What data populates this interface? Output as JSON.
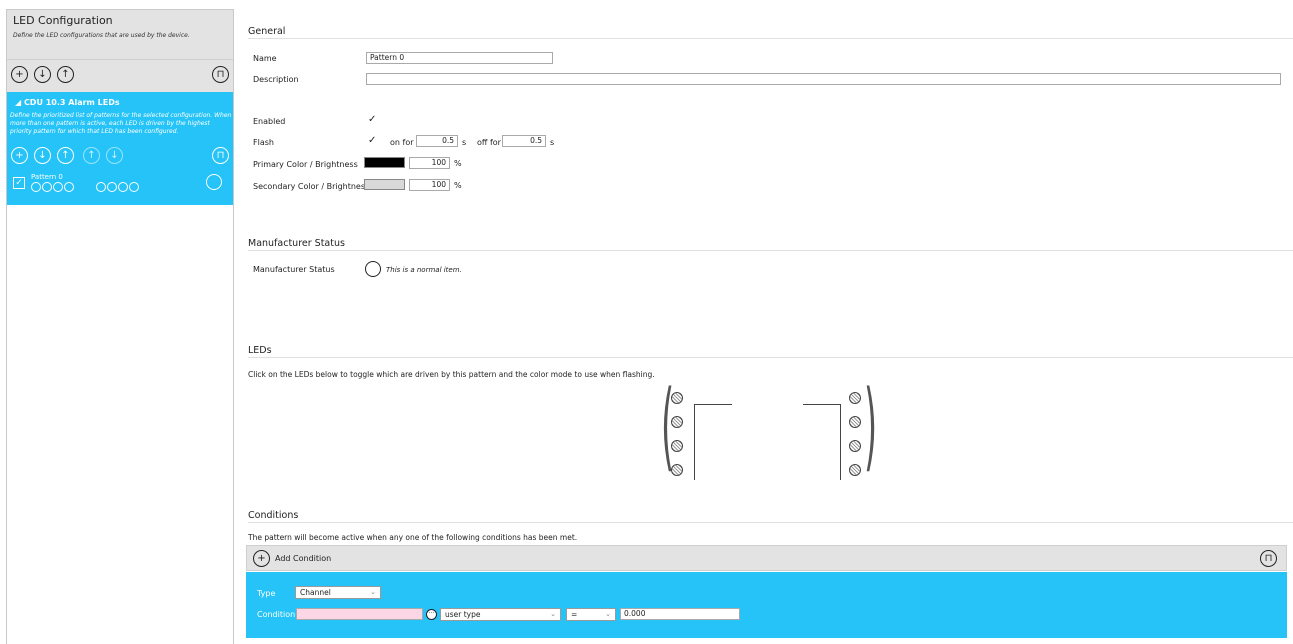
{
  "left_panel": {
    "title": "LED Configuration",
    "description": "Define the LED configurations that are used by the device.",
    "config": {
      "title": "◢  CDU 10.3 Alarm LEDs",
      "description": "Define the prioritized list of patterns for the selected configuration. When more than one pattern is active, each LED is driven by the highest priority pattern for which that LED has been configured.",
      "pattern_name": "Pattern 0",
      "pattern_check": "✓"
    }
  },
  "general": {
    "section_title": "General",
    "name_label": "Name",
    "name_value": "Pattern 0",
    "description_label": "Description",
    "description_value": "",
    "enabled_label": "Enabled",
    "enabled_check": "✓",
    "flash_label": "Flash",
    "flash_check": "✓",
    "on_for_label": "on for",
    "on_for_value": "0.5",
    "on_unit": "s",
    "off_for_label": "off for",
    "off_for_value": "0.5",
    "off_unit": "s",
    "primary_label": "Primary Color / Brightness",
    "primary_color": "#000000",
    "primary_brightness": "100",
    "primary_unit": "%",
    "secondary_label": "Secondary Color / Brightness",
    "secondary_color": "#d9d9d9",
    "secondary_brightness": "100",
    "secondary_unit": "%"
  },
  "manufacturer": {
    "section_title": "Manufacturer Status",
    "label": "Manufacturer Status",
    "status_text": "This is a normal item."
  },
  "leds": {
    "section_title": "LEDs",
    "instructions": "Click on the LEDs below to toggle which are driven by this pattern and the color mode to use when flashing."
  },
  "conditions": {
    "section_title": "Conditions",
    "intro": "The pattern will become active when any one of the following conditions has been met.",
    "add_label": "Add Condition",
    "type_label": "Type",
    "type_value": "Channel",
    "condition_label": "Condition",
    "condition_value": "",
    "user_type_value": "user type",
    "operator_value": "=",
    "threshold_value": "0.000"
  },
  "colors": {
    "accent": "#25c3f7",
    "panel_gray": "#e3e3e3"
  },
  "icons": [
    "add-icon",
    "import-icon",
    "export-icon",
    "delete-icon",
    "move-up-icon",
    "move-down-icon",
    "more-icon"
  ]
}
